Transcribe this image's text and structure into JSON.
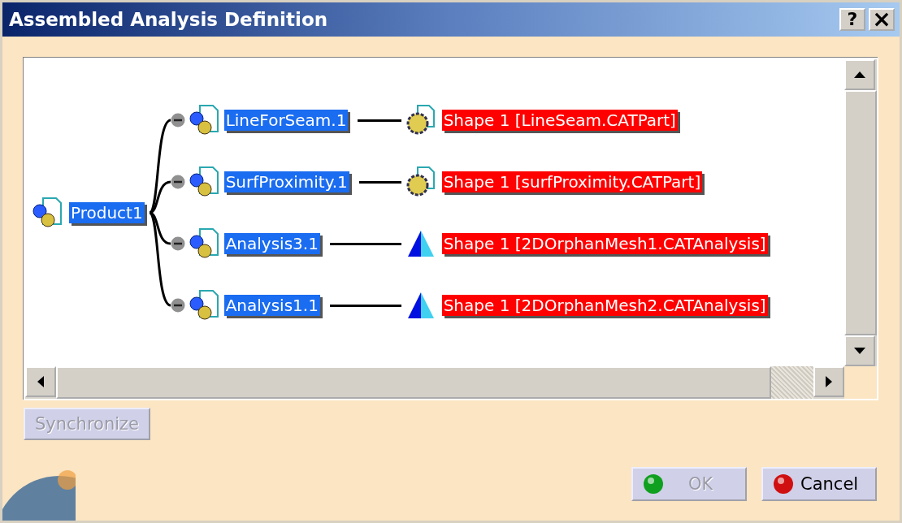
{
  "window": {
    "title": "Assembled Analysis Definition",
    "title_buttons": [
      {
        "kind": "help",
        "label": "?"
      },
      {
        "kind": "close",
        "label": "×"
      }
    ]
  },
  "tree": {
    "root": {
      "label": "Product1",
      "kind": "product",
      "selected": true
    },
    "children": [
      {
        "label": "LineForSeam.1",
        "kind": "product",
        "selected": true,
        "expanded": true,
        "link": {
          "label": "Shape 1 [LineSeam.CATPart]",
          "kind": "part",
          "color": "#ff0000"
        }
      },
      {
        "label": "SurfProximity.1",
        "kind": "product",
        "selected": true,
        "expanded": true,
        "link": {
          "label": "Shape 1 [surfProximity.CATPart]",
          "kind": "part",
          "color": "#ff0000"
        }
      },
      {
        "label": "Analysis3.1",
        "kind": "product",
        "selected": true,
        "expanded": true,
        "link": {
          "label": "Shape 1 [2DOrphanMesh1.CATAnalysis]",
          "kind": "analysis",
          "color": "#ff0000"
        }
      },
      {
        "label": "Analysis1.1",
        "kind": "product",
        "selected": true,
        "expanded": true,
        "link": {
          "label": "Shape 1 [2DOrphanMesh2.CATAnalysis]",
          "kind": "analysis",
          "color": "#ff0000"
        }
      }
    ]
  },
  "synchronize_button": {
    "label": "Synchronize",
    "disabled": true
  },
  "buttons": [
    {
      "kind": "ok",
      "label": "OK",
      "disabled": true
    },
    {
      "kind": "cancel",
      "label": "Cancel",
      "disabled": false
    }
  ]
}
